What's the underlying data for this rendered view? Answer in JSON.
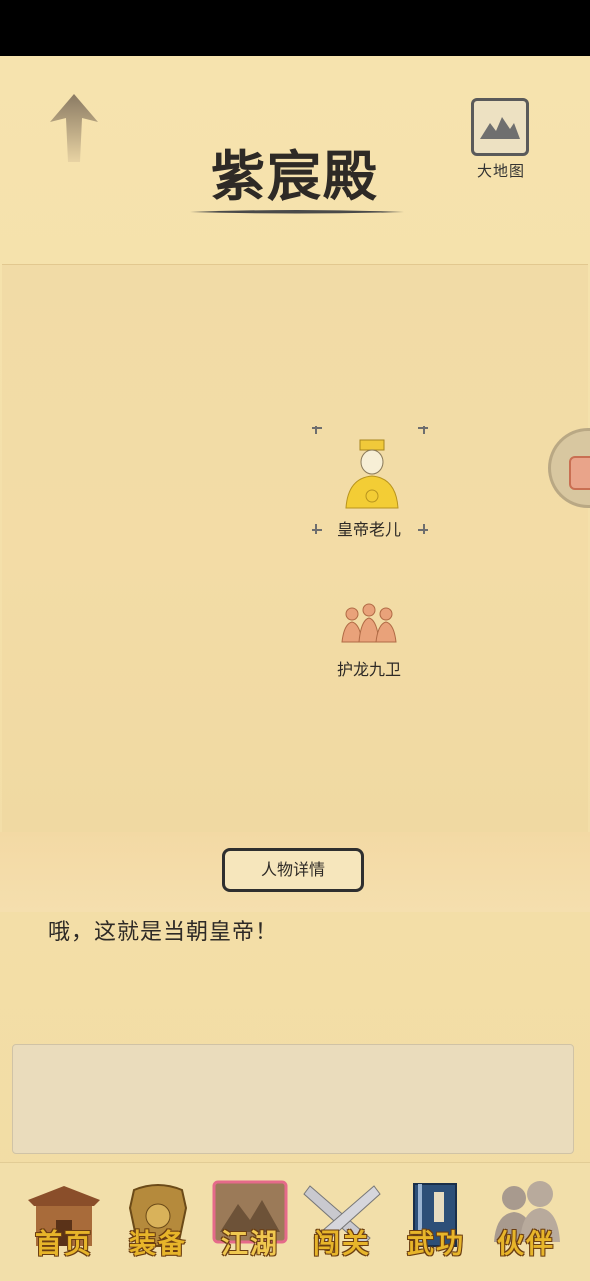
{
  "header": {
    "title": "紫宸殿",
    "map_button_label": "大地图"
  },
  "map": {
    "npcs": [
      {
        "name": "皇帝老儿",
        "selected": true
      },
      {
        "name": "护龙九卫",
        "selected": false
      }
    ]
  },
  "detail_button_label": "人物详情",
  "message": "哦，这就是当朝皇帝！",
  "log_text": "",
  "nav": {
    "items": [
      {
        "label": "首页",
        "icon": "house-icon"
      },
      {
        "label": "装备",
        "icon": "armor-icon"
      },
      {
        "label": "江湖",
        "icon": "mountain-scroll-icon",
        "active": true
      },
      {
        "label": "闯关",
        "icon": "crossed-swords-icon"
      },
      {
        "label": "武功",
        "icon": "book-icon"
      },
      {
        "label": "伙伴",
        "icon": "companions-icon"
      }
    ]
  },
  "colors": {
    "parchment": "#f3dfa8",
    "ink": "#2e2a26",
    "nav_gold": "#e7b52a"
  }
}
